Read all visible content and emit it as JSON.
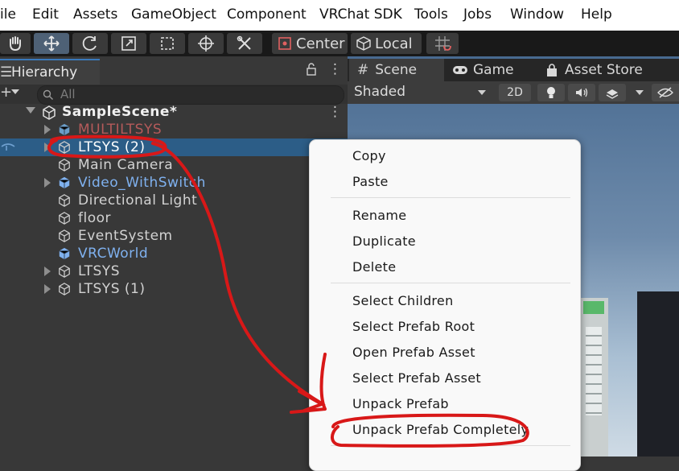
{
  "menu": [
    "ile",
    "Edit",
    "Assets",
    "GameObject",
    "Component",
    "VRChat SDK",
    "Tools",
    "Jobs",
    "Window",
    "Help"
  ],
  "toolbar": {
    "pivot_label": "Center",
    "space_label": "Local"
  },
  "hierarchy": {
    "tab_label": "Hierarchy",
    "search_placeholder": "All",
    "scene_name": "SampleScene*",
    "items": [
      {
        "label": "MULTILTSYS",
        "color": "#b55a5a",
        "prefab": true,
        "expandable": true
      },
      {
        "label": "LTSYS (2)",
        "color": "#ffffff",
        "prefab": false,
        "expandable": true,
        "selected": true
      },
      {
        "label": "Main Camera",
        "color": "#d2d2d2",
        "prefab": false,
        "expandable": false
      },
      {
        "label": "Video_WithSwitch",
        "color": "#7fb1ef",
        "prefab": true,
        "expandable": true
      },
      {
        "label": "Directional Light",
        "color": "#d2d2d2",
        "prefab": false,
        "expandable": false
      },
      {
        "label": "floor",
        "color": "#d2d2d2",
        "prefab": false,
        "expandable": false
      },
      {
        "label": "EventSystem",
        "color": "#d2d2d2",
        "prefab": false,
        "expandable": false
      },
      {
        "label": "VRCWorld",
        "color": "#7fb1ef",
        "prefab": true,
        "expandable": false
      },
      {
        "label": "LTSYS",
        "color": "#d2d2d2",
        "prefab": false,
        "expandable": true
      },
      {
        "label": "LTSYS (1)",
        "color": "#d2d2d2",
        "prefab": false,
        "expandable": true
      }
    ]
  },
  "scene_tabs": [
    {
      "label": "Scene",
      "icon": "grid-icon"
    },
    {
      "label": "Game",
      "icon": "gamepad-icon"
    },
    {
      "label": "Asset Store",
      "icon": "bag-icon"
    }
  ],
  "scene_toolbar": {
    "shading": "Shaded",
    "mode_2d": "2D"
  },
  "context_menu": {
    "items": [
      "Copy",
      "Paste",
      "Rename",
      "Duplicate",
      "Delete",
      "Select Children",
      "Select Prefab Root",
      "Open Prefab Asset",
      "Select Prefab Asset",
      "Unpack Prefab",
      "Unpack Prefab Completely"
    ]
  },
  "colors": {
    "selection": "#2c5d87",
    "annotation": "#d81818",
    "tab_accent": "#3a79bb"
  }
}
